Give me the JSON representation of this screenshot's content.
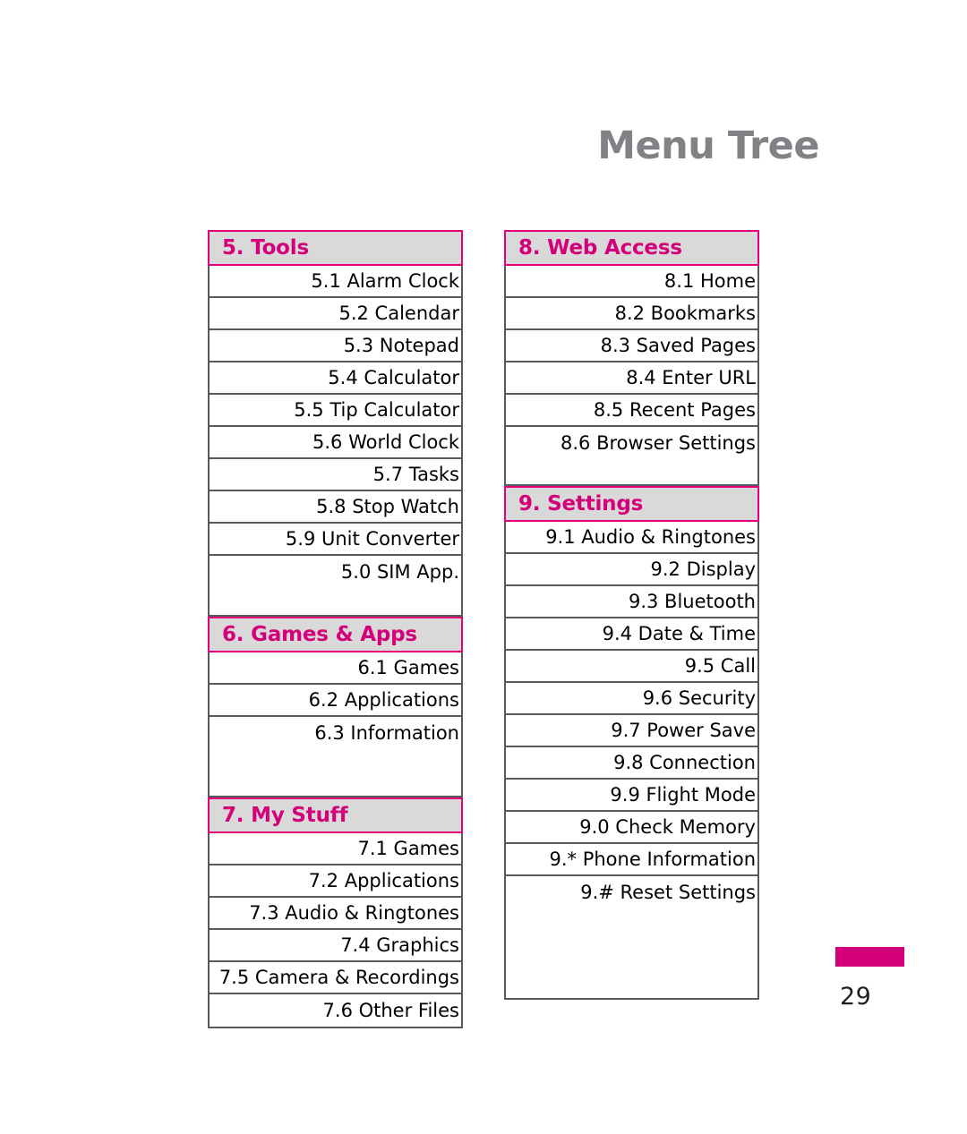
{
  "page": {
    "heading": "Menu Tree",
    "number": "29",
    "accent_color": "#d4007a",
    "header_bg_color": "#d9d9d9",
    "heading_color": "#808285",
    "border_color": "#58595b"
  },
  "columns": [
    {
      "name": "left-column",
      "sections": [
        {
          "header": "5. Tools",
          "items": [
            "5.1 Alarm Clock",
            "5.2 Calendar",
            "5.3 Notepad",
            "5.4 Calculator",
            "5.5 Tip Calculator",
            "5.6 World Clock",
            "5.7 Tasks",
            "5.8 Stop Watch",
            "5.9 Unit Converter",
            "5.0 SIM App."
          ]
        },
        {
          "header": "6. Games & Apps",
          "items": [
            "6.1 Games",
            "6.2 Applications",
            "6.3 Information"
          ]
        },
        {
          "header": "7. My Stuff",
          "items": [
            "7.1 Games",
            "7.2 Applications",
            "7.3 Audio & Ringtones",
            "7.4 Graphics",
            "7.5 Camera & Recordings",
            "7.6 Other Files"
          ]
        }
      ]
    },
    {
      "name": "right-column",
      "sections": [
        {
          "header": "8. Web Access",
          "items": [
            "8.1 Home",
            "8.2 Bookmarks",
            "8.3 Saved Pages",
            "8.4 Enter URL",
            "8.5 Recent Pages",
            "8.6 Browser Settings"
          ]
        },
        {
          "header": "9. Settings",
          "items": [
            "9.1 Audio & Ringtones",
            "9.2 Display",
            "9.3 Bluetooth",
            "9.4 Date & Time",
            "9.5 Call",
            "9.6 Security",
            "9.7 Power Save",
            "9.8 Connection",
            "9.9 Flight Mode",
            "9.0 Check Memory",
            "9.* Phone Information",
            "9.# Reset Settings"
          ]
        }
      ]
    }
  ]
}
